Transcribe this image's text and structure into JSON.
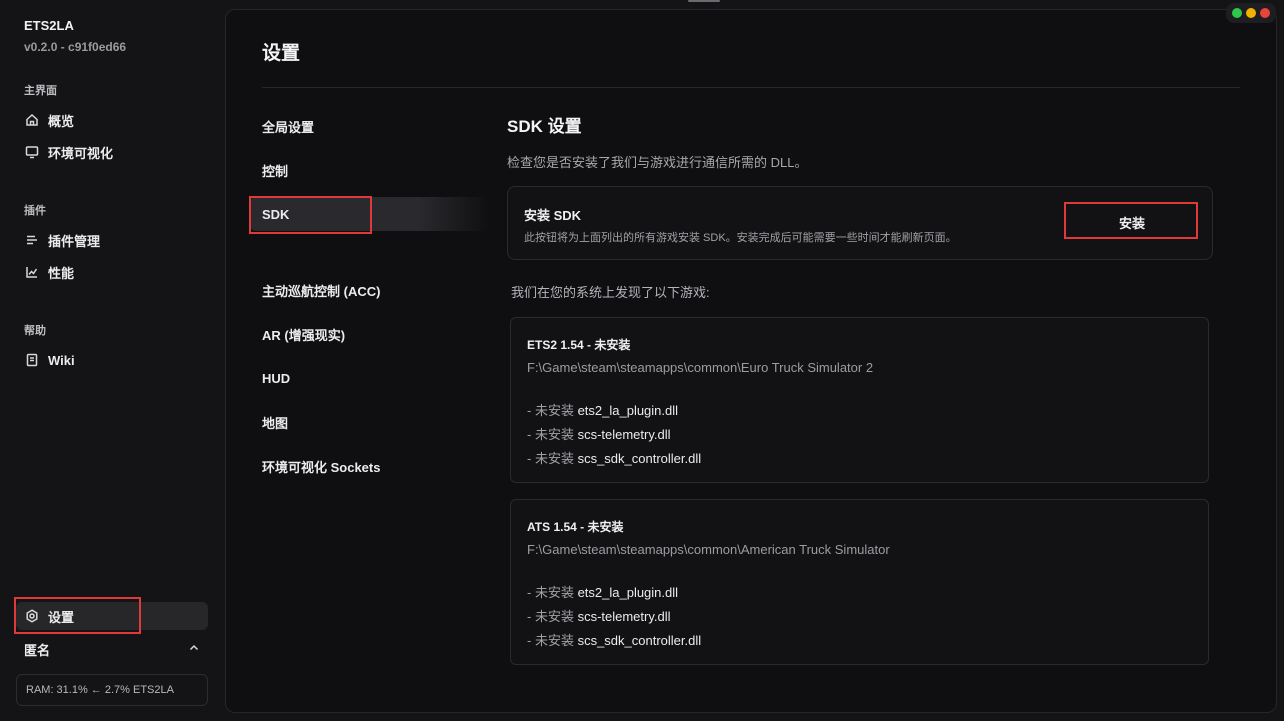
{
  "app": {
    "title": "ETS2LA",
    "version": "v0.2.0 - c91f0ed66"
  },
  "sidebar": {
    "sections": [
      {
        "label": "主界面",
        "items": [
          {
            "label": "概览",
            "icon": "home-icon"
          },
          {
            "label": "环境可视化",
            "icon": "monitor-icon"
          }
        ]
      },
      {
        "label": "插件",
        "items": [
          {
            "label": "插件管理",
            "icon": "list-icon"
          },
          {
            "label": "性能",
            "icon": "chart-icon"
          }
        ]
      },
      {
        "label": "帮助",
        "items": [
          {
            "label": "Wiki",
            "icon": "book-icon"
          }
        ]
      }
    ],
    "settings_label": "设置",
    "user_label": "匿名",
    "ram_status": "RAM: 31.1% ← 2.7% ETS2LA"
  },
  "page": {
    "title": "设置",
    "subnav": [
      "全局设置",
      "控制",
      "SDK",
      "主动巡航控制 (ACC)",
      "AR (增强现实)",
      "HUD",
      "地图",
      "环境可视化 Sockets"
    ],
    "active_subnav": "SDK"
  },
  "sdk": {
    "title": "SDK 设置",
    "description": "检查您是否安装了我们与游戏进行通信所需的 DLL。",
    "install_card": {
      "title": "安装 SDK",
      "description": "此按钮将为上面列出的所有游戏安装 SDK。安装完成后可能需要一些时间才能刷新页面。",
      "button_label": "安装"
    },
    "found_label": "我们在您的系统上发现了以下游戏:",
    "games": [
      {
        "title": "ETS2 1.54 - 未安装",
        "path": "F:\\Game\\steam\\steamapps\\common\\Euro Truck Simulator 2",
        "dlls": [
          {
            "status": "- 未安装 ",
            "name": "ets2_la_plugin.dll"
          },
          {
            "status": "- 未安装 ",
            "name": "scs-telemetry.dll"
          },
          {
            "status": "- 未安装 ",
            "name": "scs_sdk_controller.dll"
          }
        ]
      },
      {
        "title": "ATS 1.54 - 未安装",
        "path": "F:\\Game\\steam\\steamapps\\common\\American Truck Simulator",
        "dlls": [
          {
            "status": "- 未安装 ",
            "name": "ets2_la_plugin.dll"
          },
          {
            "status": "- 未安装 ",
            "name": "scs-telemetry.dll"
          },
          {
            "status": "- 未安装 ",
            "name": "scs_sdk_controller.dll"
          }
        ]
      }
    ]
  },
  "colors": {
    "highlight_outline": "#e0393a",
    "close": "#2ec94a",
    "minimize": "#f0b400",
    "maximize": "#e8443a"
  }
}
